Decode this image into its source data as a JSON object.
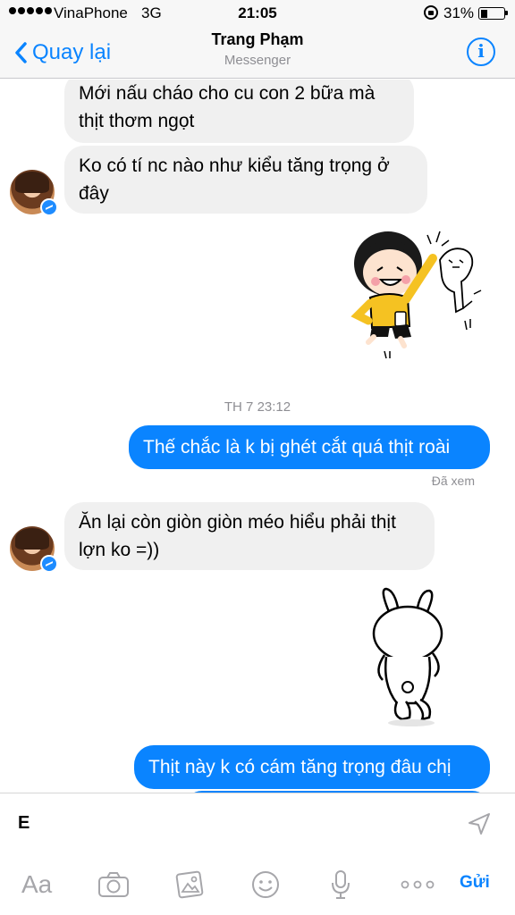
{
  "status_bar": {
    "carrier": "VinaPhone",
    "network": "3G",
    "time": "21:05",
    "battery": "31%",
    "battery_level": 0.31
  },
  "header": {
    "back_label": "Quay lại",
    "contact_name": "Trang Phạm",
    "subtitle": "Messenger",
    "info_icon": "info-icon"
  },
  "messages": [
    {
      "from": "contact",
      "text_lines": [
        "Mới nấu cháo cho cu con 2 bữa mà",
        "thịt thơm ngọt"
      ]
    },
    {
      "from": "contact",
      "text_lines": [
        "Ko có tí nc nào như kiểu tăng trọng ở",
        "đây"
      ]
    },
    {
      "from": "contact",
      "type": "sticker",
      "sticker": "girl-high-five-cat-sticker"
    },
    {
      "type": "timestamp",
      "text": "TH 7 23:12"
    },
    {
      "from": "me",
      "text_lines": [
        "Thế chắc là k bị ghét cắt quá thịt roài"
      ]
    },
    {
      "type": "receipt",
      "text": "Đã xem"
    },
    {
      "from": "contact",
      "text_lines": [
        "Ăn lại còn giòn giòn méo hiểu phải thịt",
        "lợn ko =))"
      ]
    },
    {
      "from": "me",
      "type": "sticker",
      "sticker": "rabbit-walking-away-sticker"
    },
    {
      "from": "me",
      "text_lines": [
        "Thịt này k có cám tăng trọng đâu chị"
      ]
    }
  ],
  "composer": {
    "value": "E",
    "send_icon": "send-arrow-icon"
  },
  "toolbar": {
    "aa_label": "Aa",
    "icons": [
      "camera-icon",
      "photo-gallery-icon",
      "emoji-icon",
      "microphone-icon",
      "more-icon"
    ],
    "send_label": "Gửi"
  },
  "colors": {
    "accent": "#0a84ff",
    "incoming_bubble": "#f0f0f0",
    "bar_background": "#f7f7f7"
  }
}
